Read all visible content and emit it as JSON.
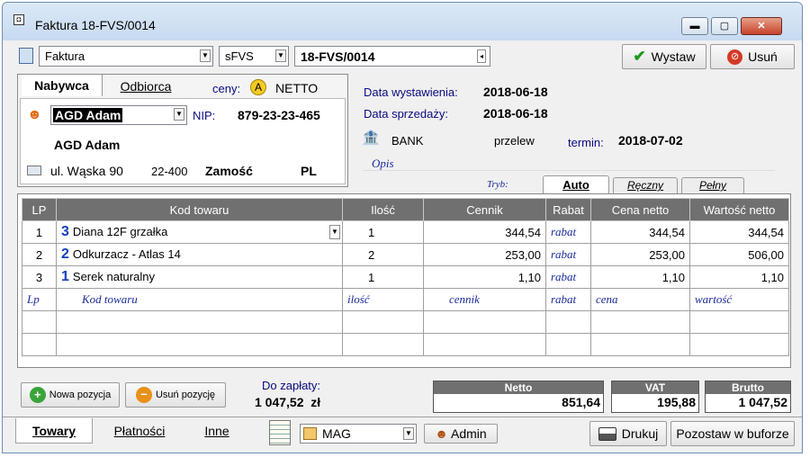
{
  "window": {
    "title": "Faktura 18-FVS/0014"
  },
  "toolbar": {
    "doc_type": "Faktura",
    "series": "sFVS",
    "number": "18-FVS/0014",
    "issue_label": "Wystaw",
    "delete_label": "Usuń"
  },
  "buyer": {
    "tab_buyer": "Nabywca",
    "tab_receiver": "Odbiorca",
    "prices_label": "ceny:",
    "prices_badge": "A",
    "prices_value": "NETTO",
    "name_select": "AGD Adam",
    "nip_label": "NIP:",
    "nip": "879-23-23-465",
    "full_name": "AGD Adam",
    "street": "ul. Wąska 90",
    "postal": "22-400",
    "city": "Zamość",
    "country": "PL"
  },
  "dates": {
    "issue_label": "Data wystawienia:",
    "issue": "2018-06-18",
    "sale_label": "Data sprzedaży:",
    "sale": "2018-06-18",
    "payment_method": "BANK",
    "payment_type": "przelew",
    "due_label": "termin:",
    "due": "2018-07-02",
    "desc_label": "Opis"
  },
  "mode": {
    "label": "Tryb:",
    "tabs": [
      "Auto",
      "Ręczny",
      "Pełny"
    ]
  },
  "table": {
    "headers": [
      "LP",
      "Kod towaru",
      "Ilość",
      "Cennik",
      "Rabat",
      "Cena netto",
      "Wartość netto"
    ],
    "rows": [
      {
        "lp": "1",
        "badge": "3",
        "name": "Diana 12F grzałka",
        "qty": "1",
        "price": "344,54",
        "discount": "rabat",
        "net_price": "344,54",
        "net_value": "344,54"
      },
      {
        "lp": "2",
        "badge": "2",
        "name": "Odkurzacz - Atlas 14",
        "qty": "2",
        "price": "253,00",
        "discount": "rabat",
        "net_price": "253,00",
        "net_value": "506,00"
      },
      {
        "lp": "3",
        "badge": "1",
        "name": "Serek naturalny",
        "qty": "1",
        "price": "1,10",
        "discount": "rabat",
        "net_price": "1,10",
        "net_value": "1,10"
      }
    ],
    "input_row": [
      "Lp",
      "Kod towaru",
      "ilość",
      "cennik",
      "rabat",
      "cena",
      "wartość"
    ]
  },
  "footer": {
    "add_label": "Nowa pozycja",
    "remove_label": "Usuń pozycję",
    "to_pay_label": "Do zapłaty:",
    "to_pay": "1 047,52  zł",
    "net_label": "Netto",
    "net": "851,64",
    "vat_label": "VAT",
    "vat": "195,88",
    "gross_label": "Brutto",
    "gross": "1 047,52"
  },
  "bottom": {
    "tabs": [
      "Towary",
      "Płatności",
      "Inne"
    ],
    "warehouse": "MAG",
    "user": "Admin",
    "print_label": "Drukuj",
    "buffer_label": "Pozostaw w buforze"
  }
}
